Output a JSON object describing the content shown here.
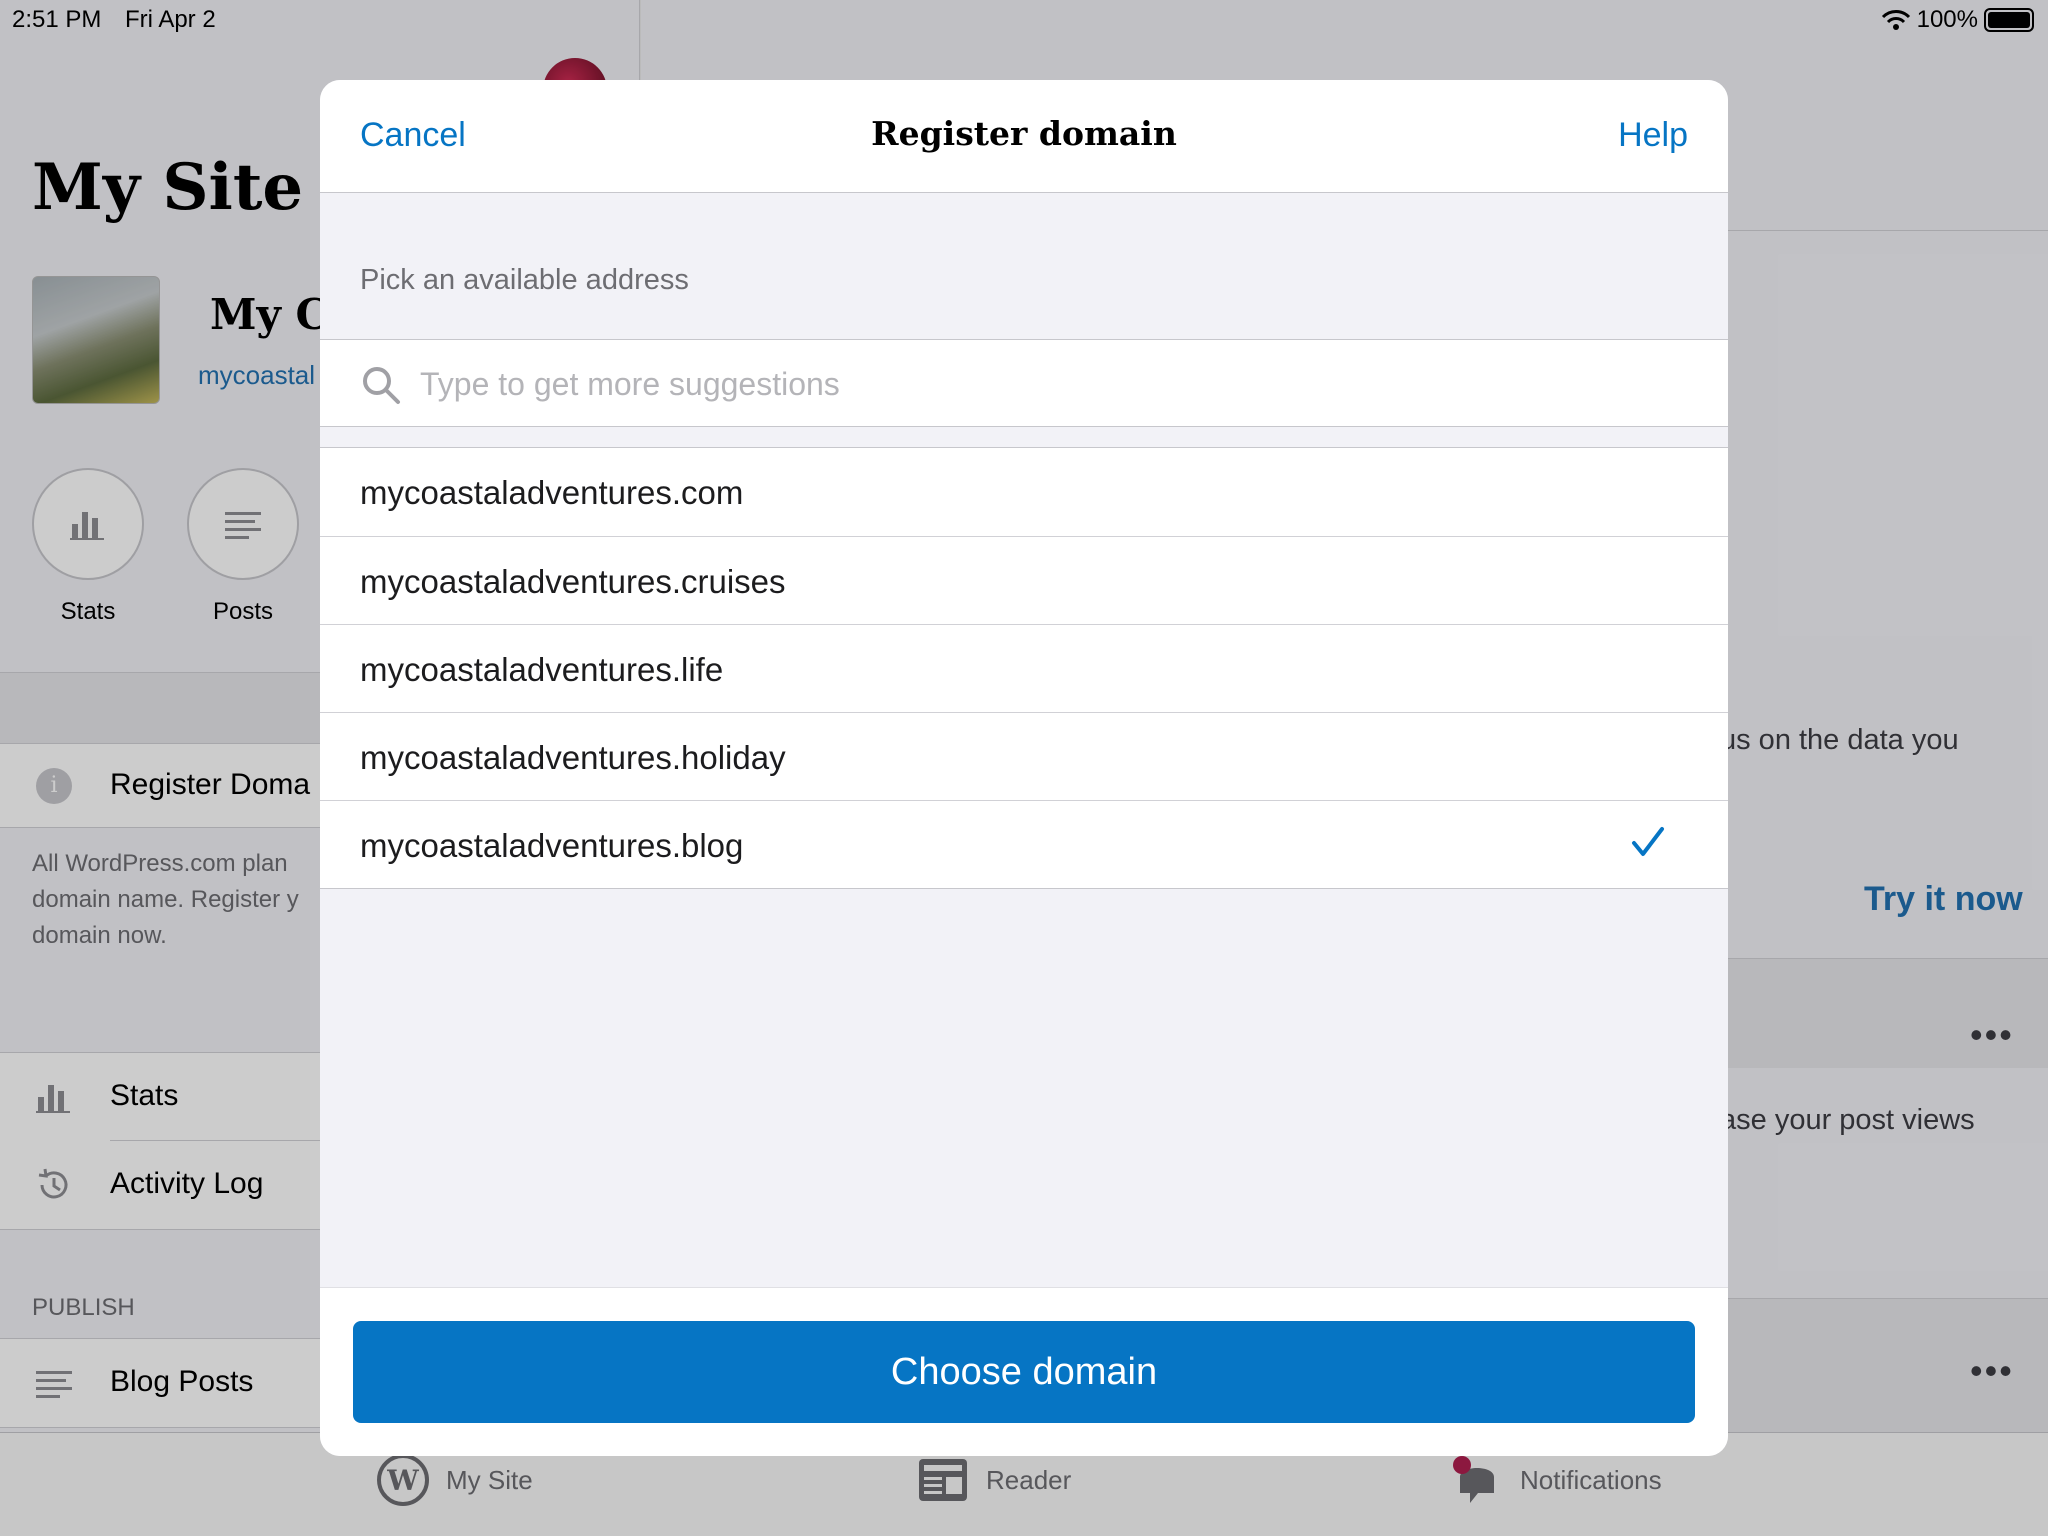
{
  "status_bar": {
    "time": "2:51 PM",
    "date": "Fri Apr 2",
    "battery": "100%"
  },
  "background": {
    "title": "My Site",
    "site_name": "My Co",
    "site_url": "mycoastal",
    "quick_actions": [
      {
        "label": "Stats",
        "icon": "stats-icon"
      },
      {
        "label": "Posts",
        "icon": "posts-icon"
      }
    ],
    "register_domain_label": "Register Doma",
    "register_desc_lines": [
      "All WordPress.com plan",
      "domain name. Register y",
      "domain now."
    ],
    "menu": [
      {
        "label": "Stats",
        "icon": "stats-icon"
      },
      {
        "label": "Activity Log",
        "icon": "history-icon"
      }
    ],
    "publish_header": "PUBLISH",
    "publish_menu": [
      {
        "label": "Blog Posts",
        "icon": "posts-icon"
      }
    ],
    "right_card_text_1": "us on the data you",
    "try_it_now": "Try it now",
    "right_card_text_2": "ase your post views",
    "more_dots": "•••"
  },
  "tab_bar": [
    {
      "label": "My Site",
      "icon": "wordpress-icon"
    },
    {
      "label": "Reader",
      "icon": "reader-icon"
    },
    {
      "label": "Notifications",
      "icon": "notifications-icon"
    }
  ],
  "modal": {
    "cancel": "Cancel",
    "title": "Register domain",
    "help": "Help",
    "section_header": "Pick an available address",
    "search_placeholder": "Type to get more suggestions",
    "domains": [
      {
        "name": "mycoastaladventures.com",
        "selected": false
      },
      {
        "name": "mycoastaladventures.cruises",
        "selected": false
      },
      {
        "name": "mycoastaladventures.life",
        "selected": false
      },
      {
        "name": "mycoastaladventures.holiday",
        "selected": false
      },
      {
        "name": "mycoastaladventures.blog",
        "selected": true
      }
    ],
    "choose_button": "Choose domain"
  },
  "colors": {
    "accent": "#0675c4",
    "link": "#2271b1",
    "notification_badge": "#b01e4f"
  }
}
